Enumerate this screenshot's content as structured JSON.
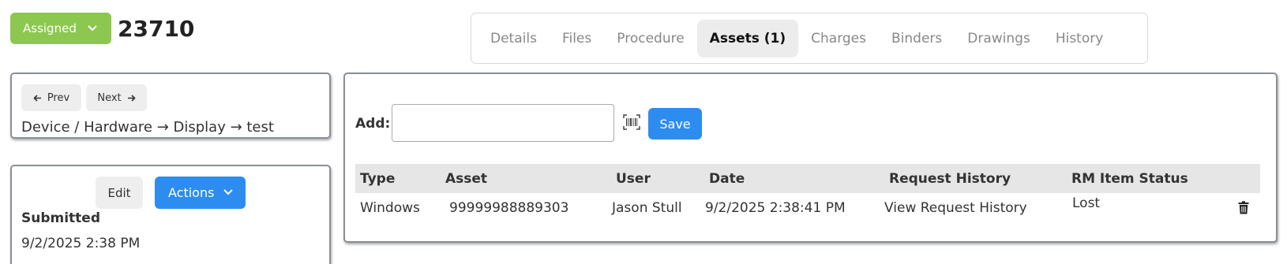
{
  "header": {
    "status_label": "Assigned",
    "record_id": "23710"
  },
  "tabs": [
    {
      "label": "Details"
    },
    {
      "label": "Files"
    },
    {
      "label": "Procedure"
    },
    {
      "label": "Assets (1)",
      "active": true
    },
    {
      "label": "Charges"
    },
    {
      "label": "Binders"
    },
    {
      "label": "Drawings"
    },
    {
      "label": "History"
    }
  ],
  "nav": {
    "prev_label": "Prev",
    "next_label": "Next",
    "breadcrumb": "Device / Hardware → Display → test"
  },
  "status_panel": {
    "edit_label": "Edit",
    "actions_label": "Actions",
    "submitted_label": "Submitted",
    "submitted_value": "9/2/2025 2:38 PM"
  },
  "assets": {
    "add_label": "Add:",
    "add_value": "",
    "save_label": "Save",
    "columns": [
      "Type",
      "Asset",
      "User",
      "Date",
      "Request History",
      "RM Item Status"
    ],
    "rows": [
      {
        "type": "Windows",
        "asset": "99999988889303",
        "user": "Jason Stull",
        "date": "9/2/2025 2:38:41 PM",
        "request_history": "View Request History",
        "rm_status": "Lost"
      }
    ]
  },
  "colors": {
    "status_green": "#8cc850",
    "primary_blue": "#2d8cf0",
    "link_blue": "#2d7ad6"
  },
  "icons": [
    "chevron-down-icon",
    "arrow-left-icon",
    "arrow-right-icon",
    "barcode-icon",
    "trash-icon"
  ]
}
